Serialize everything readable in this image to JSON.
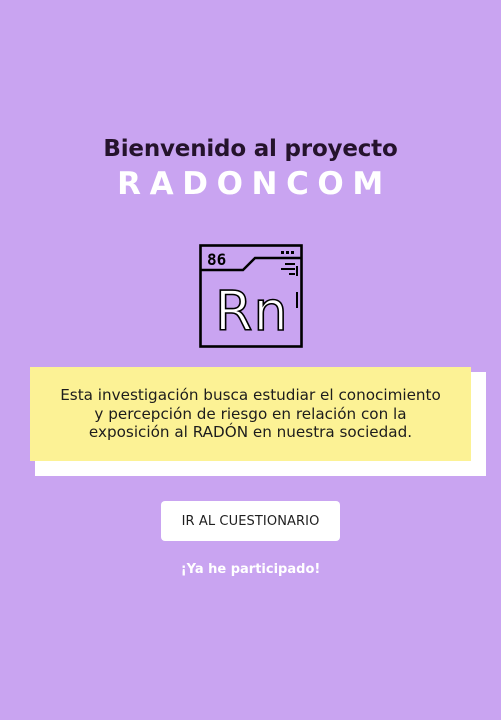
{
  "header": {
    "welcome": "Bienvenido al proyecto",
    "brand": "RADONCOM"
  },
  "element_tile": {
    "icon": "radon-element-icon",
    "atomic_number": "86",
    "symbol": "Rn"
  },
  "intro": {
    "text": "Esta investigación busca estudiar el conocimiento y percepción de riesgo en relación con la exposición al RADÓN en nuestra sociedad."
  },
  "cta": {
    "label": "IR AL CUESTIONARIO"
  },
  "secondary_link": {
    "label": "¡Ya he participado!"
  },
  "colors": {
    "background": "#c9a4f1",
    "card": "#fcf295",
    "card_shadow": "#ffffff",
    "title_dark": "#25132c",
    "brand_white": "#ffffff"
  }
}
